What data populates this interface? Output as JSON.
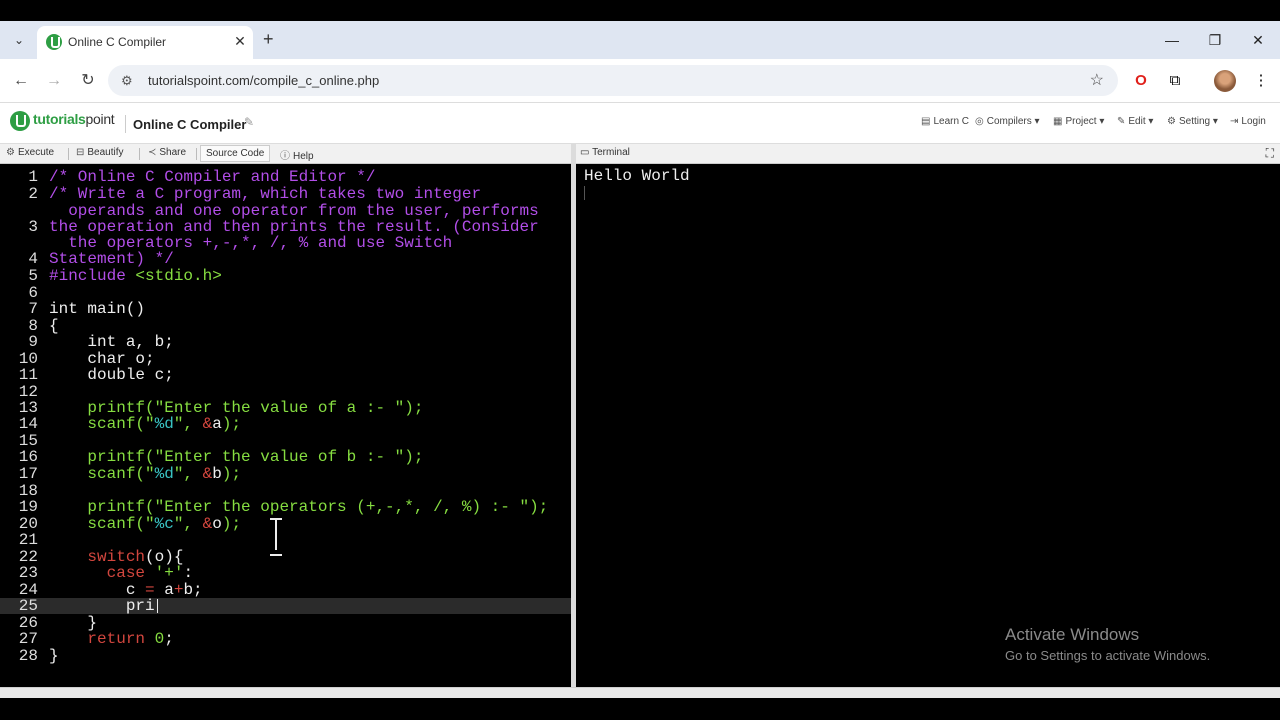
{
  "browser": {
    "tab_title": "Online C Compiler",
    "tab_close": "✕",
    "new_tab": "+",
    "url": "tutorialspoint.com/compile_c_online.php",
    "window_controls": {
      "minimize": "—",
      "maximize": "❐",
      "close": "✕"
    }
  },
  "site": {
    "logo_brand": "tutorials",
    "logo_suffix": "point",
    "page_title": "Online C Compiler",
    "nav": {
      "learn": "Learn C",
      "compilers": "Compilers",
      "project": "Project",
      "edit": "Edit",
      "setting": "Setting",
      "login": "Login"
    }
  },
  "toolbar": {
    "execute": "Execute",
    "beautify": "Beautify",
    "share": "Share",
    "source_code": "Source Code",
    "help": "Help"
  },
  "terminal": {
    "label": "Terminal",
    "output": "Hello World"
  },
  "editor": {
    "line_numbers": [
      "1",
      "2",
      "3",
      "4",
      "5",
      "6",
      "7",
      "8",
      "9",
      "10",
      "11",
      "12",
      "13",
      "14",
      "15",
      "16",
      "17",
      "18",
      "19",
      "20",
      "21",
      "22",
      "23",
      "24",
      "25",
      "26",
      "27",
      "28"
    ]
  },
  "watermark": {
    "title": "Activate Windows",
    "subtitle": "Go to Settings to activate Windows."
  }
}
